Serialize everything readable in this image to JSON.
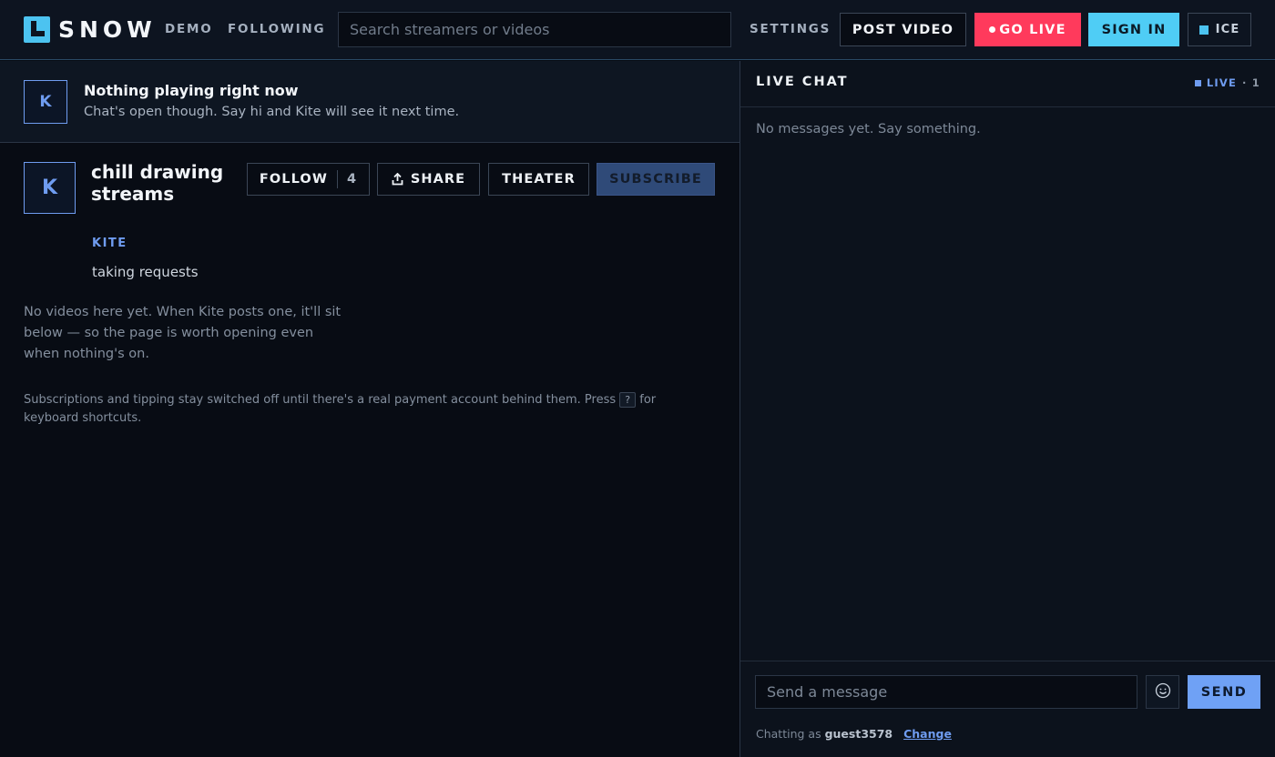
{
  "header": {
    "brand": "SNOW",
    "nav": [
      "DEMO",
      "FOLLOWING"
    ],
    "search_placeholder": "Search streamers or videos",
    "settings": "SETTINGS",
    "post_video": "POST VIDEO",
    "go_live": "GO LIVE",
    "sign_in": "SIGN IN",
    "theme": "ICE"
  },
  "banner": {
    "avatar_letter": "K",
    "title": "Nothing playing right now",
    "subtitle": "Chat's open though. Say hi and Kite will see it next time."
  },
  "channel": {
    "avatar_letter": "K",
    "stream_title": "chill drawing streams",
    "streamer": "KITE",
    "tagline": "taking requests",
    "follow_label": "FOLLOW",
    "follower_count": "4",
    "share_label": "SHARE",
    "theater_label": "THEATER",
    "subscribe_label": "SUBSCRIBE",
    "empty_videos": "No videos here yet. When Kite posts one, it'll sit below — so the page is worth opening even when nothing's on.",
    "footnote_before": "Subscriptions and tipping stay switched off until there's a real payment account behind them. Press",
    "footnote_key": "?",
    "footnote_after": "for keyboard shortcuts."
  },
  "chat": {
    "title": "LIVE CHAT",
    "status": "LIVE",
    "viewers": "· 1",
    "empty": "No messages yet. Say something.",
    "input_placeholder": "Send a message",
    "send": "SEND",
    "chatting_as": "Chatting as",
    "username": "guest3578",
    "change": "Change"
  },
  "colors": {
    "accent": "#4cc3f0",
    "live": "#ff3a5c",
    "link": "#6f9cf0",
    "background": "#080c14"
  }
}
